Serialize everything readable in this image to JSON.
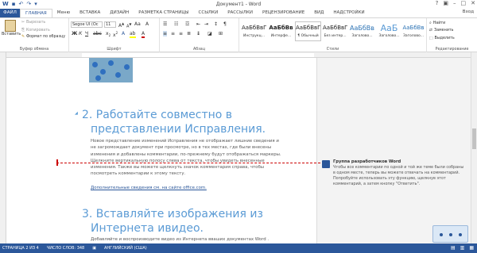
{
  "title": "Документ1 - Word",
  "qat_icons": [
    "word-logo-icon",
    "save-icon",
    "undo-icon",
    "redo-icon"
  ],
  "user": "Вход",
  "tabs": {
    "file": "ФАЙЛ",
    "home": "ГЛАВНАЯ",
    "menu": "Меню",
    "insert": "ВСТАВКА",
    "design": "ДИЗАЙН",
    "layout": "РАЗМЕТКА СТРАНИЦЫ",
    "references": "ССЫЛКИ",
    "mailings": "РАССЫЛКИ",
    "review": "РЕЦЕНЗИРОВАНИЕ",
    "view": "ВИД",
    "addins": "НАДСТРОЙКИ"
  },
  "clipboard": {
    "paste": "Вставить",
    "cut": "Вырезать",
    "copy": "Копировать",
    "format_painter": "Формат по образцу",
    "label": "Буфер обмена"
  },
  "font": {
    "name": "Segoe UI (Ос",
    "size": "11",
    "label": "Шрифт"
  },
  "paragraph": {
    "label": "Абзац"
  },
  "styles": {
    "label": "Стили",
    "items": [
      {
        "sample": "АаБбВвГ",
        "name": "Инструкц..."
      },
      {
        "sample": "АаБбВв",
        "name": "Интерфе..."
      },
      {
        "sample": "АаБбВвГ",
        "name": "¶ Обычный"
      },
      {
        "sample": "АаБбВвГ",
        "name": "Без интер..."
      },
      {
        "sample": "АаБбВв",
        "name": "Заголово..."
      },
      {
        "sample": "АаБ",
        "name": "Заголово..."
      },
      {
        "sample": "АаБбВв",
        "name": "Заголово..."
      },
      {
        "sample": "АаБбВвГ",
        "name": "Заголово..."
      }
    ]
  },
  "editing": {
    "find": "Найти",
    "replace": "Заменить",
    "select": "Выделить",
    "label": "Редактирование"
  },
  "document": {
    "heading2": "2. Работайте совместно в представлении Исправления.",
    "heading2_line1": "2. Работайте совместно в",
    "heading2_line2": "представлении Исправления.",
    "body2": "Новое представление изменений Исправления не отображает лишние сведения и не загромождает документ при просмотре, но в тех местах, где были внесены изменения и добавлены комментарии, по-прежнему будут отображаться маркеры. Щелкните вертикальную полосу слева от текста, чтобы увидеть внесенные изменения. Также вы можете щелкнуть значок комментария справа, чтобы посмотреть комментарии к этому тексту.",
    "link": "Дополнительные сведения см. на сайте office.com.",
    "heading3_line1": "3. Вставляйте изображения из",
    "heading3_line2": "Интернета ивидео.",
    "body3": "Добавляйте и воспроизводите видео из Интернета ввaших документах Word ."
  },
  "comment": {
    "author": "Группа разработчиков Word",
    "text": "Чтобы все комментарии по одной и той же теме были собраны в одном месте, теперь вы можете отвечать на комментарий. Попробуйте использовать эту функцию, щелкнув этот комментарий, а затем кнопку \"Ответить\"."
  },
  "status": {
    "page": "СТРАНИЦА 2 ИЗ 4",
    "words": "ЧИСЛО СЛОВ: 348",
    "lang": "АНГЛИЙСКИЙ (США)"
  },
  "colors": {
    "accent": "#2b579a",
    "heading": "#5b9bd5",
    "status_bar": "#2b579a"
  }
}
